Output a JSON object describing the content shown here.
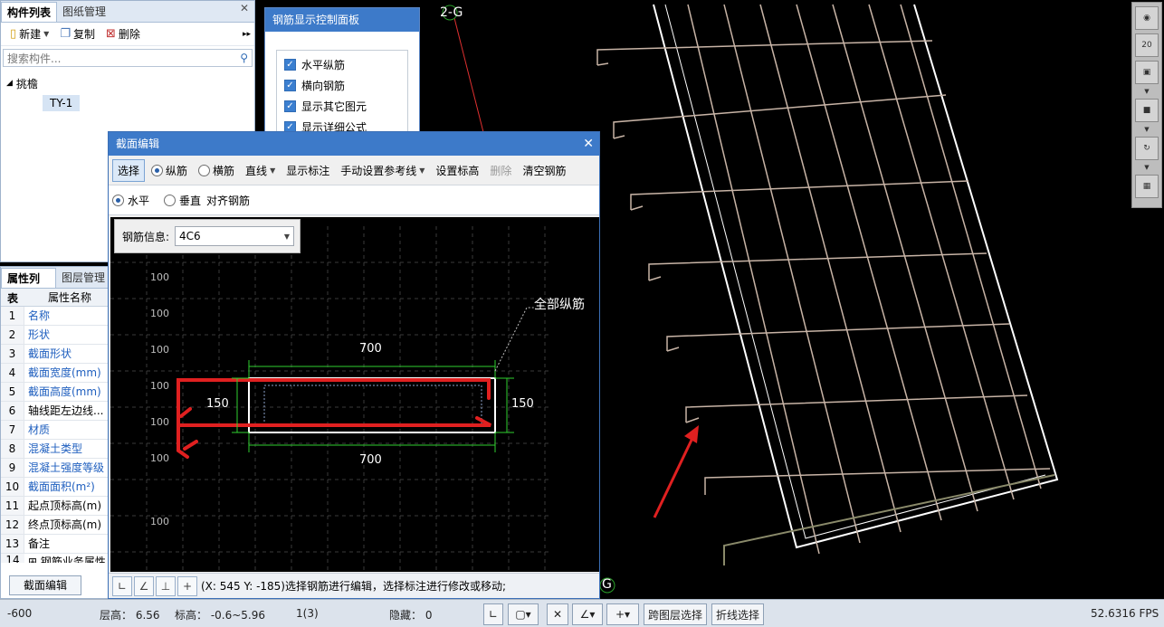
{
  "left_panel": {
    "tabs": [
      "构件列表",
      "图纸管理"
    ],
    "toolbar": {
      "new": "新建",
      "copy": "复制",
      "delete": "删除"
    },
    "search_placeholder": "搜索构件...",
    "tree_root": "挑檐",
    "tree_leaf": "TY-1"
  },
  "props_panel": {
    "tabs": [
      "属性列表",
      "图层管理"
    ],
    "column_header": "属性名称",
    "rows": [
      {
        "num": "1",
        "name": "名称",
        "blue": true
      },
      {
        "num": "2",
        "name": "形状",
        "blue": true
      },
      {
        "num": "3",
        "name": "截面形状",
        "blue": true
      },
      {
        "num": "4",
        "name": "截面宽度(mm)",
        "blue": true
      },
      {
        "num": "5",
        "name": "截面高度(mm)",
        "blue": true
      },
      {
        "num": "6",
        "name": "轴线距左边线...",
        "blue": false
      },
      {
        "num": "7",
        "name": "材质",
        "blue": true
      },
      {
        "num": "8",
        "name": "混凝土类型",
        "blue": true
      },
      {
        "num": "9",
        "name": "混凝土强度等级",
        "blue": true
      },
      {
        "num": "10",
        "name": "截面面积(m²)",
        "blue": true
      },
      {
        "num": "11",
        "name": "起点顶标高(m)",
        "blue": false
      },
      {
        "num": "12",
        "name": "终点顶标高(m)",
        "blue": false
      },
      {
        "num": "13",
        "name": "备注",
        "blue": false
      }
    ],
    "section_edit_button": "截面编辑"
  },
  "rebar_panel": {
    "title": "钢筋显示控制面板",
    "options": [
      "水平纵筋",
      "横向钢筋",
      "显示其它图元",
      "显示详细公式"
    ]
  },
  "dialog": {
    "title": "截面编辑",
    "toolbar": {
      "select": "选择",
      "long_bar": "纵筋",
      "trans_bar": "横筋",
      "line": "直线",
      "show_dim": "显示标注",
      "manual_ref": "手动设置参考线",
      "set_elev": "设置标高",
      "delete": "删除",
      "clear": "清空钢筋"
    },
    "toolbar2": {
      "horizontal": "水平",
      "vertical": "垂直",
      "align": "对齐钢筋"
    },
    "rebar_info_label": "钢筋信息:",
    "rebar_info_value": "4C6",
    "grid_labels": [
      "100",
      "100",
      "100",
      "100",
      "100",
      "100",
      "100"
    ],
    "dims": {
      "top": "700",
      "bottom": "700",
      "left": "150",
      "right": "150"
    },
    "annotation": "全部纵筋",
    "status_text": "(X: 545 Y: -185)选择钢筋进行编辑，选择标注进行修改或移动;"
  },
  "viewport": {
    "axis_label_top": "2-G",
    "axis_label_bottom": "G"
  },
  "statusbar": {
    "coord": "-600",
    "floor_height": "层高： 6.56",
    "elevation": "标高： -0.6~5.96",
    "count": "1(3)",
    "hidden": "隐藏： 0",
    "cross_layer": "跨图层选择",
    "polyline": "折线选择",
    "fps": "52.6316 FPS"
  },
  "right_toolbar": {
    "scale_label": "20"
  },
  "colors": {
    "title_blue": "#3d7ac9",
    "rebar_red": "#e02020",
    "dim_green": "#2fd02f",
    "mesh_tan": "#c8b4a6"
  }
}
